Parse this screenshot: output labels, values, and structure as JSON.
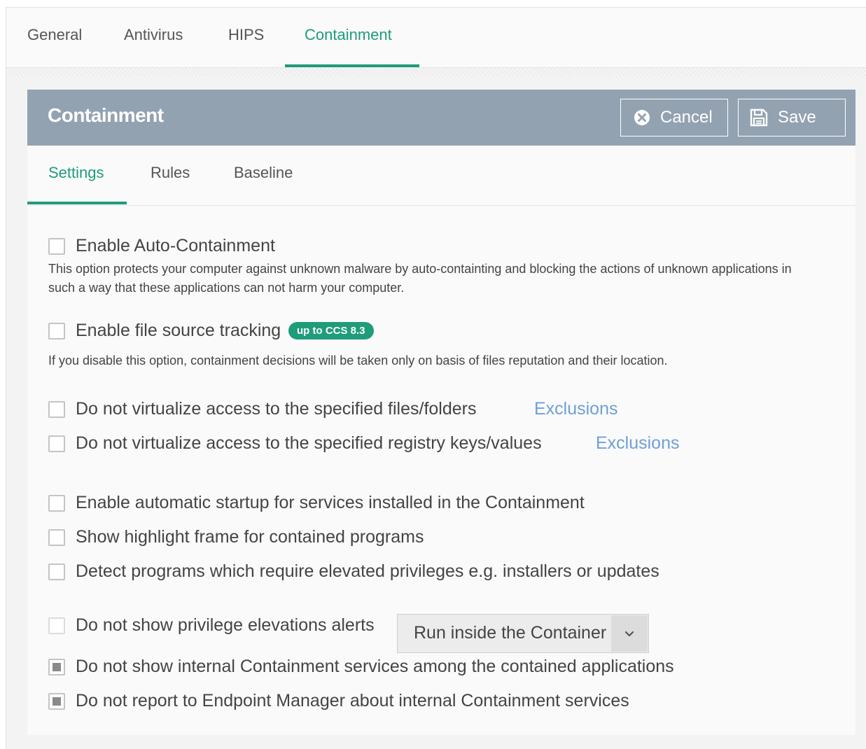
{
  "top_tabs": [
    {
      "label": "General"
    },
    {
      "label": "Antivirus"
    },
    {
      "label": "HIPS"
    },
    {
      "label": "Containment",
      "active": true
    }
  ],
  "panel": {
    "title": "Containment",
    "cancel_label": "Cancel",
    "save_label": "Save"
  },
  "sub_tabs": [
    {
      "label": "Settings",
      "active": true
    },
    {
      "label": "Rules"
    },
    {
      "label": "Baseline"
    }
  ],
  "options": {
    "auto_containment": {
      "label": "Enable Auto-Containment",
      "description": "This option protects your computer against unknown malware by auto-containting and blocking the actions of unknown applications in such a way that these applications can not harm your computer.",
      "checked": false
    },
    "file_source_tracking": {
      "label": "Enable file source tracking",
      "badge": "up to CCS 8.3",
      "description": "If you disable this option, containment decisions will be taken only on basis of files reputation and their location.",
      "checked": false
    },
    "no_virtualize_files": {
      "label": "Do not virtualize access to the specified files/folders",
      "link": "Exclusions",
      "checked": false
    },
    "no_virtualize_registry": {
      "label": "Do not virtualize access to the specified registry keys/values",
      "link": "Exclusions",
      "checked": false
    },
    "auto_startup_services": {
      "label": "Enable automatic startup for services installed in the Containment",
      "checked": false
    },
    "highlight_frame": {
      "label": "Show highlight frame for contained programs",
      "checked": false
    },
    "detect_elevated": {
      "label": "Detect programs which require elevated privileges e.g. installers or updates",
      "checked": false
    },
    "no_privilege_alerts": {
      "label": "Do not show privilege elevations alerts",
      "checked": false,
      "disabled": true,
      "select_value": "Run inside the Container"
    },
    "hide_internal_services": {
      "label": "Do not show internal Containment services among the contained applications",
      "checked": true
    },
    "no_report_internal": {
      "label": "Do not report to Endpoint Manager about internal Containment services",
      "checked": true
    }
  },
  "colors": {
    "accent": "#1f9c7a",
    "header_bg": "#93a2b1",
    "link": "#6f9fd6"
  },
  "icons": {
    "cancel": "close-circle-icon",
    "save": "floppy-disk-icon",
    "select": "chevron-down-icon"
  }
}
